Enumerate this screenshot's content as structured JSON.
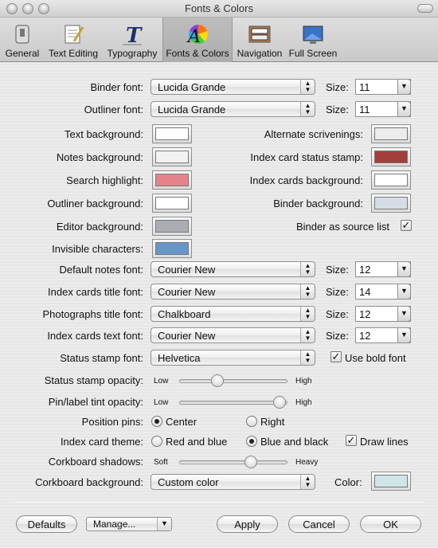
{
  "window": {
    "title": "Fonts & Colors"
  },
  "toolbar": {
    "general": "General",
    "text_editing": "Text Editing",
    "typography": "Typography",
    "fonts_colors": "Fonts & Colors",
    "navigation": "Navigation",
    "full_screen": "Full Screen"
  },
  "fonts": {
    "binder_label": "Binder font:",
    "binder_value": "Lucida Grande",
    "binder_size": "11",
    "outliner_label": "Outliner font:",
    "outliner_value": "Lucida Grande",
    "outliner_size": "11",
    "size_label": "Size:"
  },
  "colors": {
    "text_bg_label": "Text background:",
    "text_bg": "#ffffff",
    "notes_bg_label": "Notes background:",
    "notes_bg": "#f2f2f2",
    "search_label": "Search highlight:",
    "search": "#e4848a",
    "outliner_bg_label": "Outliner background:",
    "outliner_bg": "#ffffff",
    "editor_bg_label": "Editor background:",
    "editor_bg": "#a9adb2",
    "invisible_label": "Invisible characters:",
    "invisible": "#6896c8",
    "alt_scriv_label": "Alternate scrivenings:",
    "alt_scriv": "#ececec",
    "stamp_label": "Index card status stamp:",
    "stamp": "#a43e3c",
    "cards_bg_label": "Index cards background:",
    "cards_bg": "#ffffff",
    "binder_bg_label": "Binder background:",
    "binder_bg": "#d6dde6",
    "binder_source_label": "Binder as source list"
  },
  "card_fonts": {
    "notes_label": "Default notes font:",
    "notes_value": "Courier New",
    "notes_size": "12",
    "title_label": "Index cards title font:",
    "title_value": "Courier New",
    "title_size": "14",
    "photo_label": "Photographs title font:",
    "photo_value": "Chalkboard",
    "photo_size": "12",
    "text_label": "Index cards text font:",
    "text_value": "Courier New",
    "text_size": "12",
    "stamp_label": "Status stamp font:",
    "stamp_value": "Helvetica",
    "bold_label": "Use bold font"
  },
  "sliders": {
    "stamp_opacity_label": "Status stamp opacity:",
    "stamp_opacity": 0.33,
    "tint_label": "Pin/label tint opacity:",
    "tint": 0.98,
    "low": "Low",
    "high": "High",
    "shadows_label": "Corkboard shadows:",
    "shadows": 0.68,
    "soft": "Soft",
    "heavy": "Heavy"
  },
  "options": {
    "pins_label": "Position pins:",
    "center": "Center",
    "right": "Right",
    "theme_label": "Index card theme:",
    "red_blue": "Red and blue",
    "blue_black": "Blue and black",
    "draw_lines": "Draw lines",
    "cork_bg_label": "Corkboard background:",
    "cork_bg_value": "Custom color",
    "color_label": "Color:",
    "cork_color": "#cfe6e8"
  },
  "buttons": {
    "defaults": "Defaults",
    "manage": "Manage...",
    "apply": "Apply",
    "cancel": "Cancel",
    "ok": "OK"
  }
}
